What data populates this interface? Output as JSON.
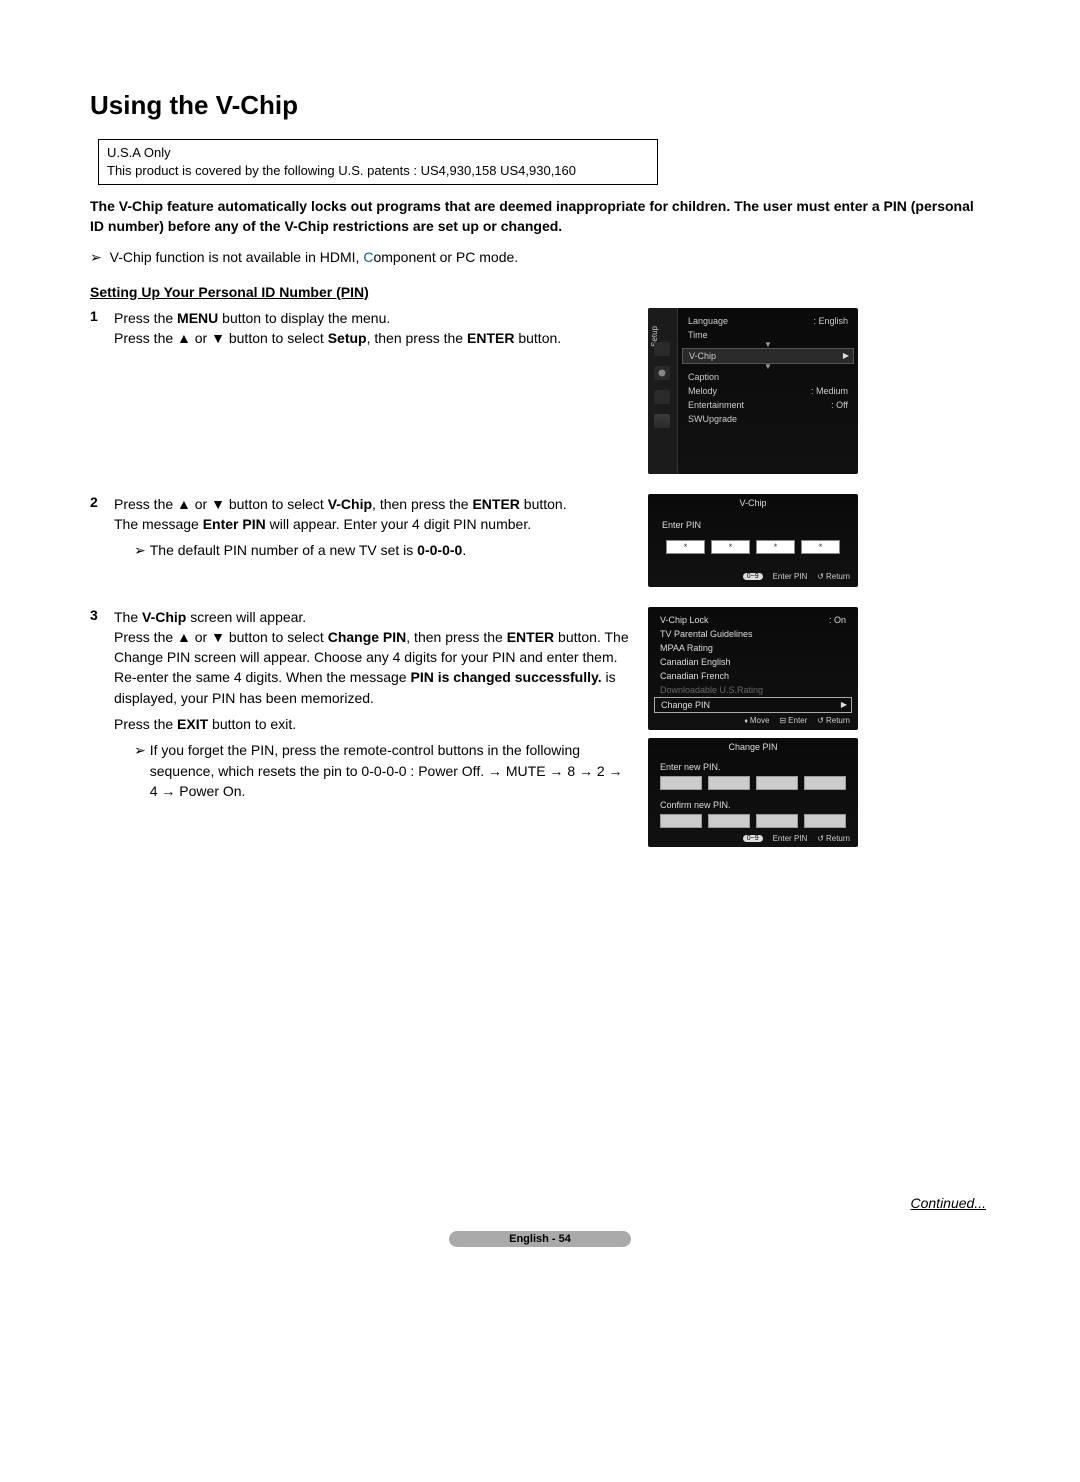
{
  "page_title": "Using the V-Chip",
  "patent_box": {
    "line1": "U.S.A Only",
    "line2": "This product is covered by the following U.S. patents : US4,930,158 US4,930,160"
  },
  "intro": "The V-Chip feature automatically locks out programs that are deemed inappropriate for children. The user must enter a PIN (personal ID number) before any of the V-Chip restrictions are set up or changed.",
  "note_prefix": "V-Chip function is not available in HDMI, ",
  "note_component": "C",
  "note_suffix": "omponent or PC mode.",
  "subhead": "Setting Up Your Personal ID Number (PIN)",
  "steps": {
    "s1": {
      "num": "1",
      "a": "Press the ",
      "menu": "MENU",
      "b": " button to display the menu.",
      "c": "Press the ▲ or ▼ button to select ",
      "setup": "Setup",
      "d": ", then press the ",
      "enter": "ENTER",
      "e": " button."
    },
    "s2": {
      "num": "2",
      "a": "Press the ▲ or ▼ button to select ",
      "vchip": "V-Chip",
      "b": ", then press the ",
      "enter": "ENTER",
      "c": " button.",
      "d": "The message ",
      "enterpin": "Enter PIN",
      "e": " will appear. Enter your 4 digit PIN number.",
      "note_a": "The default PIN number of a new TV set is ",
      "note_b": "0-0-0-0",
      "note_c": "."
    },
    "s3": {
      "num": "3",
      "a": "The ",
      "vchip": "V-Chip",
      "b": " screen will appear.",
      "c": "Press the ▲ or ▼ button to select ",
      "change": "Change PIN",
      "d": ", then press the ",
      "enter": "ENTER",
      "e": " button. The Change PIN screen will appear. Choose any 4 digits for your PIN and enter them. Re-enter the same 4 digits. When the message ",
      "success": "PIN is changed successfully.",
      "f": " is displayed, your PIN has been memorized.",
      "g": "Press the ",
      "exit": "EXIT",
      "h": " button to exit.",
      "note": "If you forget the PIN, press the remote-control buttons in the following sequence, which resets the pin to 0-0-0-0 : Power Off. → MUTE → 8 → 2 → 4 → Power On."
    }
  },
  "osd_setup": {
    "sidebar_label": "Setup",
    "items": [
      {
        "label": "Language",
        "value": ": English"
      },
      {
        "label": "Time",
        "value": ""
      },
      {
        "label": "V-Chip",
        "value": "",
        "sel": true
      },
      {
        "label": "Caption",
        "value": ""
      },
      {
        "label": "Melody",
        "value": ": Medium"
      },
      {
        "label": "Entertainment",
        "value": ": Off"
      },
      {
        "label": "SWUpgrade",
        "value": ""
      }
    ]
  },
  "osd_pin": {
    "title": "V-Chip",
    "label": "Enter PIN",
    "footer_badge": "0~9",
    "footer_enter": "Enter PIN",
    "footer_return": "Return"
  },
  "osd_vmenu": {
    "items": [
      {
        "label": "V-Chip Lock",
        "value": ": On"
      },
      {
        "label": "TV Parental Guidelines",
        "value": ""
      },
      {
        "label": "MPAA Rating",
        "value": ""
      },
      {
        "label": "Canadian English",
        "value": ""
      },
      {
        "label": "Canadian French",
        "value": ""
      },
      {
        "label": "Downloadable U.S.Rating",
        "value": "",
        "dim": true
      },
      {
        "label": "Change PIN",
        "value": "",
        "sel": true
      }
    ],
    "move": "Move",
    "enter": "Enter",
    "ret": "Return"
  },
  "osd_change": {
    "title": "Change PIN",
    "enter_new": "Enter new PIN.",
    "confirm_new": "Confirm new PIN.",
    "footer_badge": "0~9",
    "footer_enter": "Enter PIN",
    "footer_return": "Return"
  },
  "continued": "Continued...",
  "footer": "English - 54"
}
